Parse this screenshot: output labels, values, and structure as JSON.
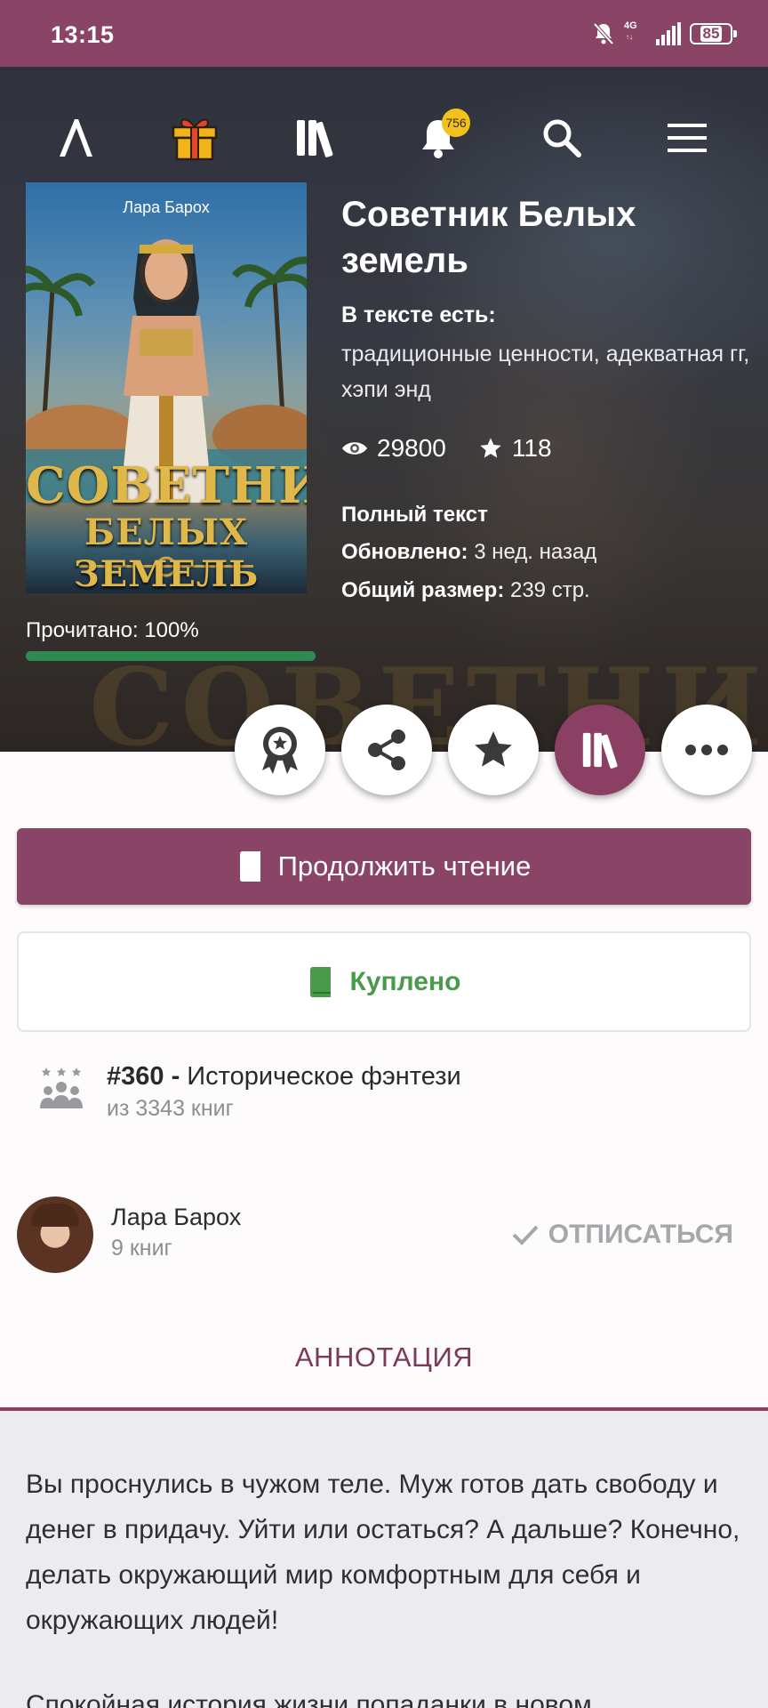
{
  "status_bar": {
    "time": "13:15",
    "network": "4G",
    "battery": "85"
  },
  "nav": {
    "notifications_count": "756",
    "icons": [
      "logo-icon",
      "gift-icon",
      "library-icon",
      "bell-icon",
      "search-icon",
      "menu-icon"
    ]
  },
  "book": {
    "cover_author": "Лара Барох",
    "cover_title_line1": "СОВЕТНИК",
    "cover_title_line2": "БЕЛЫХ ЗЕМЕЛЬ",
    "title": "Советник Белых земель",
    "tags_label": "В тексте есть:",
    "tags": "традиционные ценности, адекватная гг, хэпи энд",
    "views": "29800",
    "rating": "118",
    "status": "Полный текст",
    "updated_label": "Обновлено:",
    "updated_value": "3 нед. назад",
    "size_label": "Общий размер:",
    "size_value": "239 стр.",
    "read_label": "Прочитано: 100%",
    "read_progress": 1.0
  },
  "actions": {
    "continue_label": "Продолжить чтение",
    "bought_label": "Куплено",
    "circle_icons": [
      "award-icon",
      "share-icon",
      "star-icon",
      "library-icon",
      "more-icon"
    ]
  },
  "rank": {
    "position": "#360 -",
    "genre": "Историческое фэнтези",
    "total": "из 3343 книг"
  },
  "author": {
    "name": "Лара Барох",
    "books": "9 книг",
    "unsubscribe_label": "ОТПИСАТЬСЯ"
  },
  "tabs": {
    "annotation": "АННОТАЦИЯ"
  },
  "annotation": {
    "paragraph1": "Вы проснулись в чужом теле. Муж готов дать свободу и денег в придачу. Уйти или остаться? А дальше? Конечно, делать окружающий мир комфортным для себя и окружающих людей!",
    "paragraph2": "Спокойная история жизни попаданки в новом"
  },
  "colors": {
    "brand": "#8a4466",
    "progress": "#2e8a4e",
    "bought": "#4a9a4c",
    "badge": "#f3c11e"
  }
}
